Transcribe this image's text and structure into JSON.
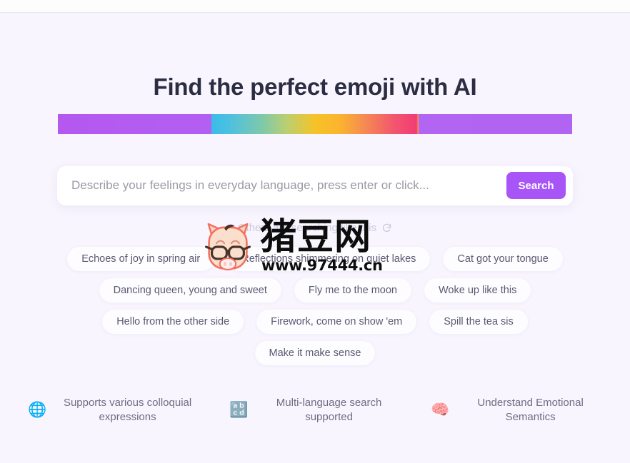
{
  "page": {
    "background_color": "#f8f5fe",
    "title": "Find the perfect emoji with AI"
  },
  "gradient_bar": {
    "left_color": "#b458f0",
    "rainbow_colors": [
      "#39bde8",
      "#7fc9a8",
      "#f6c327",
      "#f58a52",
      "#f33b73"
    ],
    "right_color": "#b163f2"
  },
  "search": {
    "placeholder": "Describe your feelings in everyday language, press enter or click...",
    "value": "",
    "button_label": "Search",
    "button_color": "#a855f7"
  },
  "suggestions": {
    "caption": "Others are searching like this",
    "refresh_icon": "refresh-icon",
    "rows": [
      [
        "Echoes of joy in spring air",
        "Reflections shimmering on quiet lakes",
        "Cat got your tongue"
      ],
      [
        "Dancing queen, young and sweet",
        "Fly me to the moon",
        "Woke up like this"
      ],
      [
        "Hello from the other side",
        "Firework, come on show 'em",
        "Spill the tea sis"
      ],
      [
        "Make it make sense"
      ]
    ]
  },
  "features": [
    {
      "icon": "🌐",
      "icon_name": "globe-icon",
      "label": "Supports various colloquial expressions"
    },
    {
      "icon": "🔡",
      "icon_name": "abc-input-icon",
      "label": "Multi-language search supported"
    },
    {
      "icon": "🧠",
      "icon_name": "brain-icon",
      "label": "Understand Emotional Semantics"
    }
  ],
  "watermark": {
    "brand_cn": "猪豆网",
    "url": "www.97444.cn",
    "mascot": "pig-mascot-icon"
  }
}
